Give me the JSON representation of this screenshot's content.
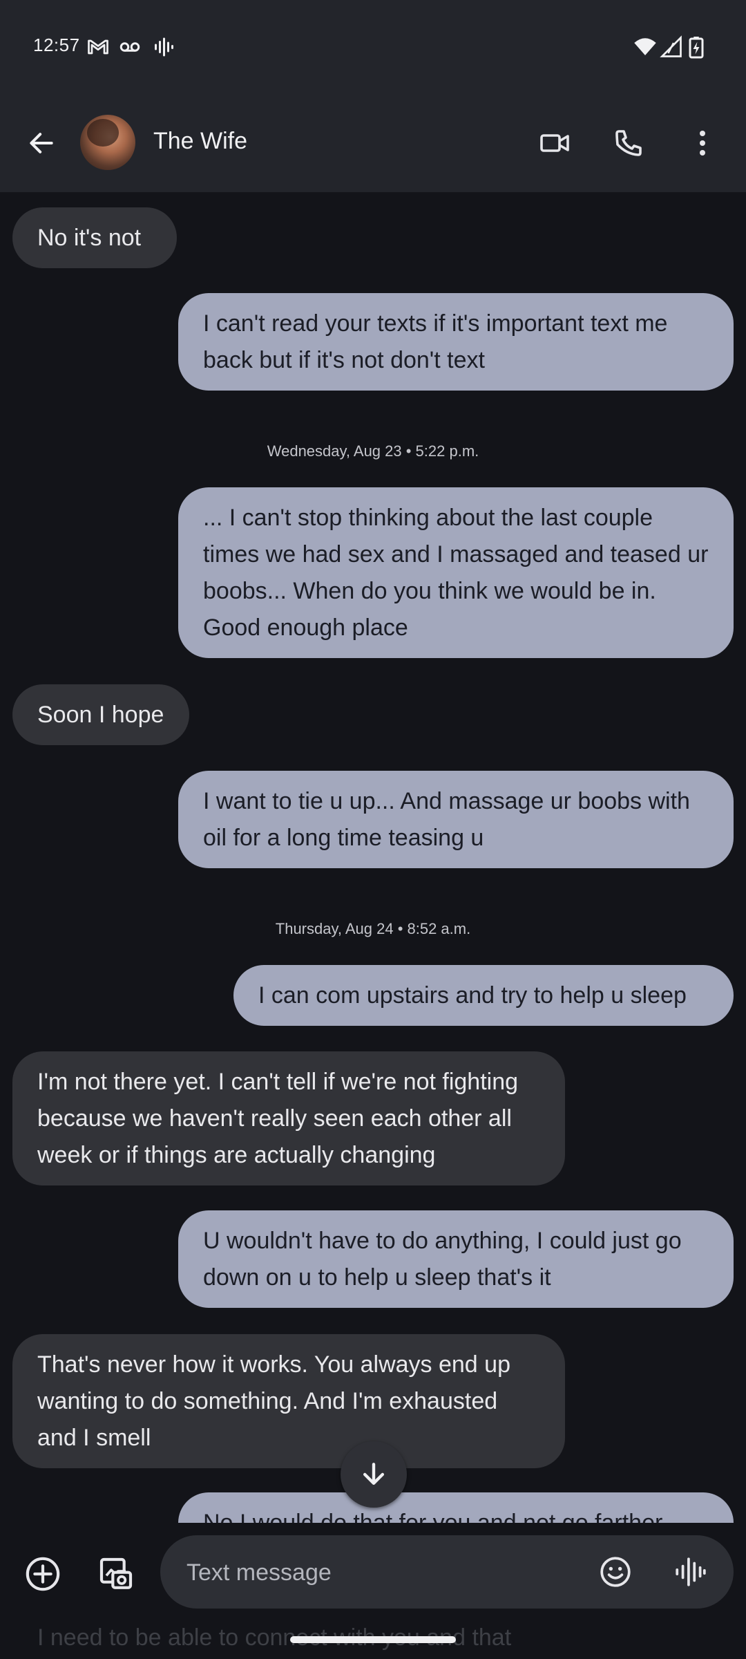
{
  "status_bar": {
    "time": "12:57",
    "left_icons": [
      "gmail-icon",
      "voicemail-icon",
      "sound-wave-icon"
    ],
    "right_icons": [
      "wifi-icon",
      "signal-icon",
      "battery-charging-icon"
    ]
  },
  "header": {
    "contact_name": "The Wife",
    "actions": [
      "video-call-icon",
      "phone-call-icon",
      "more-options-icon"
    ]
  },
  "messages": [
    {
      "dir": "in",
      "text": "No it's not"
    },
    {
      "dir": "out",
      "text": "I can't read your texts if it's important text me back but if it's not don't text"
    },
    {
      "type": "timestamp",
      "text": "Wednesday, Aug 23 • 5:22 p.m."
    },
    {
      "dir": "out",
      "text": "... I can't stop thinking about the last couple times we had sex and I massaged and teased ur boobs... When do you think we would be in. Good enough place"
    },
    {
      "dir": "in",
      "text": "Soon I hope"
    },
    {
      "dir": "out",
      "text": "I want to tie u up... And massage ur boobs with oil for a long time teasing u"
    },
    {
      "type": "timestamp",
      "text": "Thursday, Aug 24 • 8:52 a.m."
    },
    {
      "dir": "out",
      "text": "I can com upstairs and try to help u sleep"
    },
    {
      "dir": "in",
      "text": "I'm not there yet. I can't tell if we're not fighting because we haven't really seen each other all week or if things are actually changing"
    },
    {
      "dir": "out",
      "text": "U wouldn't have to do anything, I could just go down on u to help u sleep that's it"
    },
    {
      "dir": "in",
      "text": "That's never how it works. You always end up wanting to do something. And I'm exhausted and I smell"
    },
    {
      "dir": "out",
      "text": "No I would do that for you and not go farther"
    }
  ],
  "compose": {
    "placeholder": "Text message",
    "left_icons": [
      "add-icon",
      "gallery-icon"
    ],
    "right_icons": [
      "emoji-icon",
      "voice-message-icon"
    ]
  },
  "peek_text": "I need to be able to connect with you and that",
  "colors": {
    "incoming_bubble": "#323338",
    "outgoing_bubble": "#a3a8bd",
    "background": "#131419",
    "app_bar": "#23252b"
  }
}
